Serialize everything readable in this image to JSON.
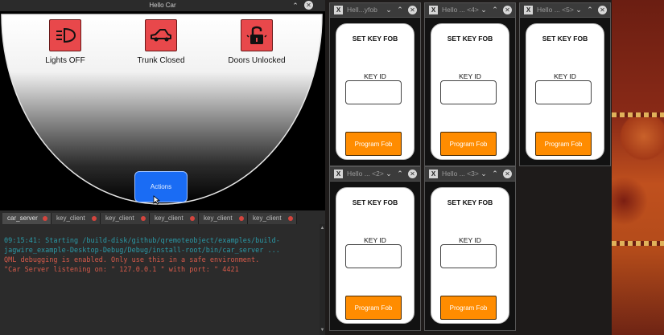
{
  "car_window": {
    "title": "Hello Car",
    "indicators": [
      {
        "icon": "headlight-icon",
        "label": "Lights OFF"
      },
      {
        "icon": "car-trunk-icon",
        "label": "Trunk Closed"
      },
      {
        "icon": "padlock-open-icon",
        "label": "Doors Unlocked"
      }
    ],
    "actions_label": "Actions"
  },
  "console": {
    "tabs": [
      "car_server",
      "key_client",
      "key_client",
      "key_client",
      "key_client",
      "key_client"
    ],
    "lines": [
      "09:15:41: Starting /build-disk/github/qremoteobject/examples/build-",
      "jagwire_example-Desktop-Debug/Debug/install-root/bin/car_server ...",
      "QML debugging is enabled. Only use this in a safe environment.",
      "\"Car Server listening on: \" 127.0.0.1 \" with port: \" 4421"
    ]
  },
  "fob_windows": [
    {
      "title": "Hell...yfob",
      "heading": "SET KEY FOB",
      "key_label": "KEY ID",
      "button": "Program Fob"
    },
    {
      "title": "Hello ... <4>",
      "heading": "SET KEY FOB",
      "key_label": "KEY ID",
      "button": "Program Fob"
    },
    {
      "title": "Hello ... <5>",
      "heading": "SET KEY FOB",
      "key_label": "KEY ID",
      "button": "Program Fob"
    },
    {
      "title": "Hello ... <2>",
      "heading": "SET KEY FOB",
      "key_label": "KEY ID",
      "button": "Program Fob"
    },
    {
      "title": "Hello ... <3>",
      "heading": "SET KEY FOB",
      "key_label": "KEY ID",
      "button": "Program Fob"
    }
  ],
  "colors": {
    "indicator_red": "#e8484b",
    "actions_blue": "#1a6cf4",
    "program_orange": "#ff8c00",
    "console_teal": "#2b9aa8",
    "console_red": "#d65a4a"
  }
}
